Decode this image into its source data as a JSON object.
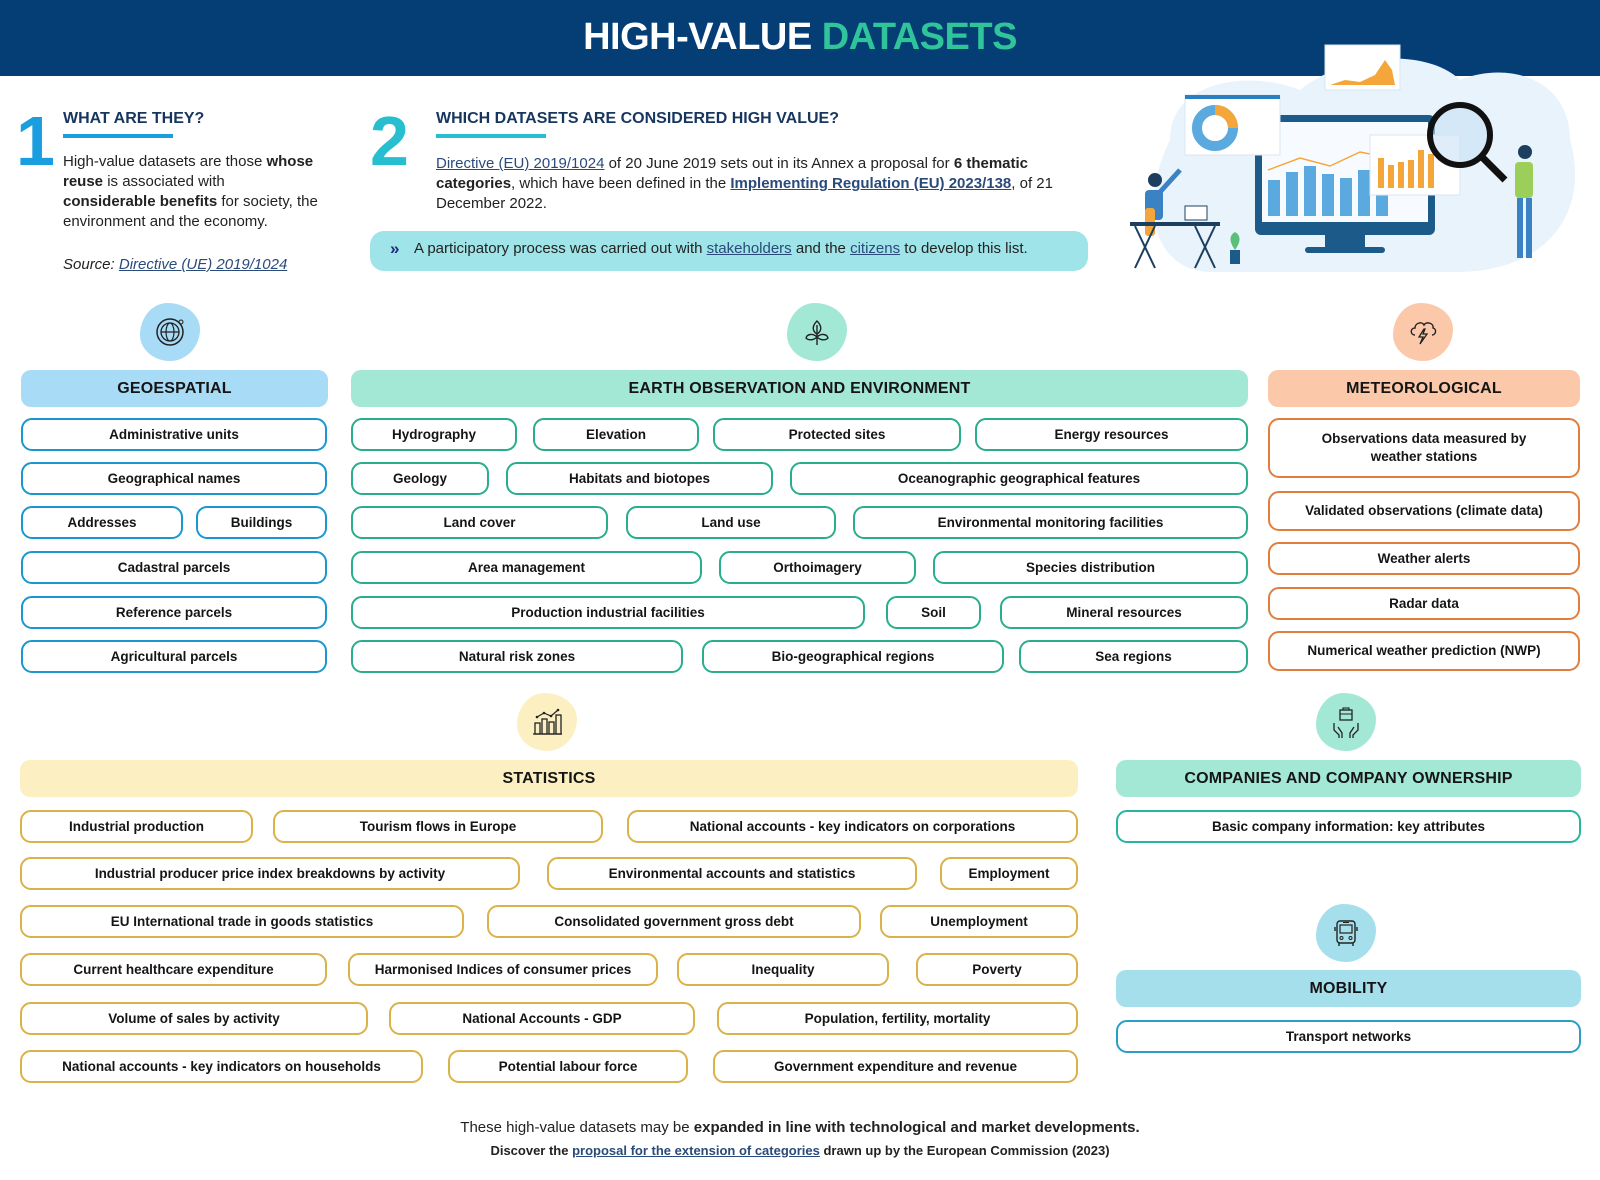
{
  "header": {
    "title_part1": "HIGH-VALUE",
    "title_part2": "DATASETS"
  },
  "section1": {
    "number": "1",
    "heading": "WHAT ARE THEY?",
    "body": [
      {
        "text": "High-value datasets are those ",
        "bold": false
      },
      {
        "text": "whose reuse",
        "bold": true
      },
      {
        "text": " is associated with ",
        "bold": false
      },
      {
        "text": "considerable benefits",
        "bold": true
      },
      {
        "text": " for society, the environment and the economy.",
        "bold": false
      }
    ],
    "source_label": "Source: ",
    "source_link": "Directive (UE) 2019/1024"
  },
  "section2": {
    "number": "2",
    "heading": "WHICH DATASETS ARE CONSIDERED HIGH VALUE?",
    "link1": "Directive (EU) 2019/1024",
    "text1": " of 20 June 2019 sets out in its Annex a proposal for ",
    "bold1": "6 thematic categories",
    "text2": ", which have been defined in the ",
    "link2": "Implementing Regulation (EU) 2023/138",
    "text3": ", of 21 December 2022.",
    "callout": {
      "icon": "double-chevron-right",
      "text1": "A participatory process was carried out with ",
      "link1": "stakeholders",
      "text2": " and the ",
      "link2": "citizens",
      "text3": " to develop this list."
    }
  },
  "colors": {
    "header_bg": "#043e75",
    "title_accent": "#2fc49a",
    "geospatial": "#a8dbf5",
    "earth_observation": "#a3e8d5",
    "meteorological": "#fbc9a9",
    "statistics": "#fcf0c2",
    "companies": "#a3e8d5",
    "mobility": "#a6dfec"
  },
  "categories": {
    "geospatial": {
      "title": "GEOESPATIAL",
      "icon": "globe-icon",
      "items": [
        "Administrative units",
        "Geographical names",
        "Addresses",
        "Buildings",
        "Cadastral parcels",
        "Reference parcels",
        "Agricultural parcels"
      ]
    },
    "earth_observation": {
      "title": "EARTH OBSERVATION AND ENVIRONMENT",
      "icon": "plant-icon",
      "items": [
        "Hydrography",
        "Elevation",
        "Protected sites",
        "Energy resources",
        "Geology",
        "Habitats and biotopes",
        "Oceanographic geographical features",
        "Land cover",
        "Land use",
        "Environmental monitoring facilities",
        "Area management",
        "Orthoimagery",
        "Species distribution",
        "Production industrial facilities",
        "Soil",
        "Mineral resources",
        "Natural risk zones",
        "Bio-geographical regions",
        "Sea regions"
      ]
    },
    "meteorological": {
      "title": "METEOROLOGICAL",
      "icon": "storm-cloud-icon",
      "items": [
        "Observations data measured by weather stations",
        "Validated observations (climate data)",
        "Weather alerts",
        "Radar data",
        "Numerical weather prediction (NWP)"
      ]
    },
    "statistics": {
      "title": "STATISTICS",
      "icon": "bar-chart-icon",
      "items": [
        "Industrial production",
        "Tourism flows in Europe",
        "National accounts - key indicators on corporations",
        "Industrial producer price index breakdowns by activity",
        "Environmental accounts and statistics",
        "Employment",
        "EU International trade in goods statistics",
        "Consolidated government gross debt",
        "Unemployment",
        "Current healthcare expenditure",
        "Harmonised Indices of consumer prices",
        "Inequality",
        "Poverty",
        "Volume of sales by activity",
        "National Accounts - GDP",
        "Population, fertility, mortality",
        "National accounts - key indicators on households",
        "Potential labour force",
        "Government expenditure and revenue"
      ]
    },
    "companies": {
      "title": "COMPANIES AND COMPANY OWNERSHIP",
      "icon": "briefcase-hands-icon",
      "items": [
        "Basic company information: key attributes"
      ]
    },
    "mobility": {
      "title": "MOBILITY",
      "icon": "bus-icon",
      "items": [
        "Transport networks"
      ]
    }
  },
  "footer": {
    "line1_text": "These high-value datasets may be ",
    "line1_bold": "expanded in line with technological and market developments.",
    "line2_text1": "Discover the ",
    "line2_link": "proposal for the extension of categories",
    "line2_text2": " drawn up by the European Commission (2023)"
  }
}
